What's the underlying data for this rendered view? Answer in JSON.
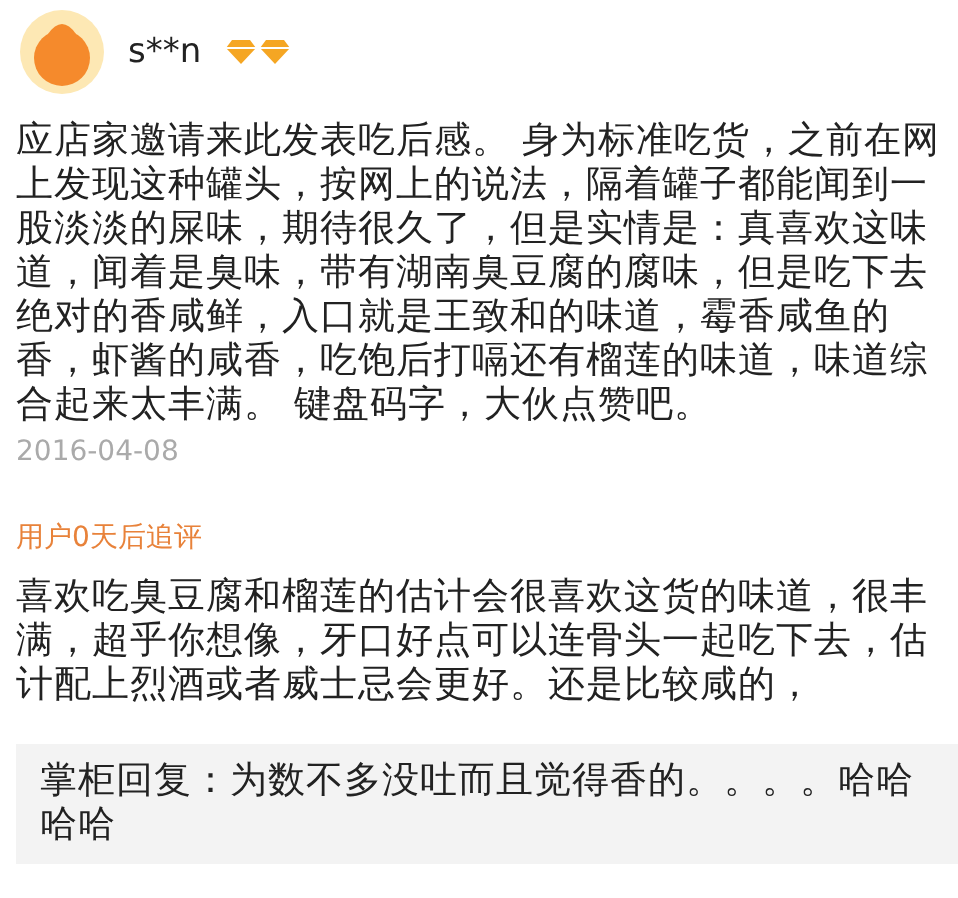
{
  "review": {
    "user": "s**n",
    "text": "应店家邀请来此发表吃后感。 身为标准吃货，之前在网上发现这种罐头，按网上的说法，隔着罐子都能闻到一股淡淡的屎味，期待很久了，但是实情是：真喜欢这味道，闻着是臭味，带有湖南臭豆腐的腐味，但是吃下去绝对的香咸鲜，入口就是王致和的味道，霉香咸鱼的香，虾酱的咸香，吃饱后打嗝还有榴莲的味道，味道综合起来太丰满。 键盘码字，大伙点赞吧。",
    "date": "2016-04-08"
  },
  "follow_up": {
    "label": "用户0天后追评",
    "text": "喜欢吃臭豆腐和榴莲的估计会很喜欢这货的味道，很丰满，超乎你想像，牙口好点可以连骨头一起吃下去，估计配上烈酒或者威士忌会更好。还是比较咸的，",
    "reply": "掌柜回复：为数不多没吐而且觉得香的。。。。哈哈哈哈"
  }
}
